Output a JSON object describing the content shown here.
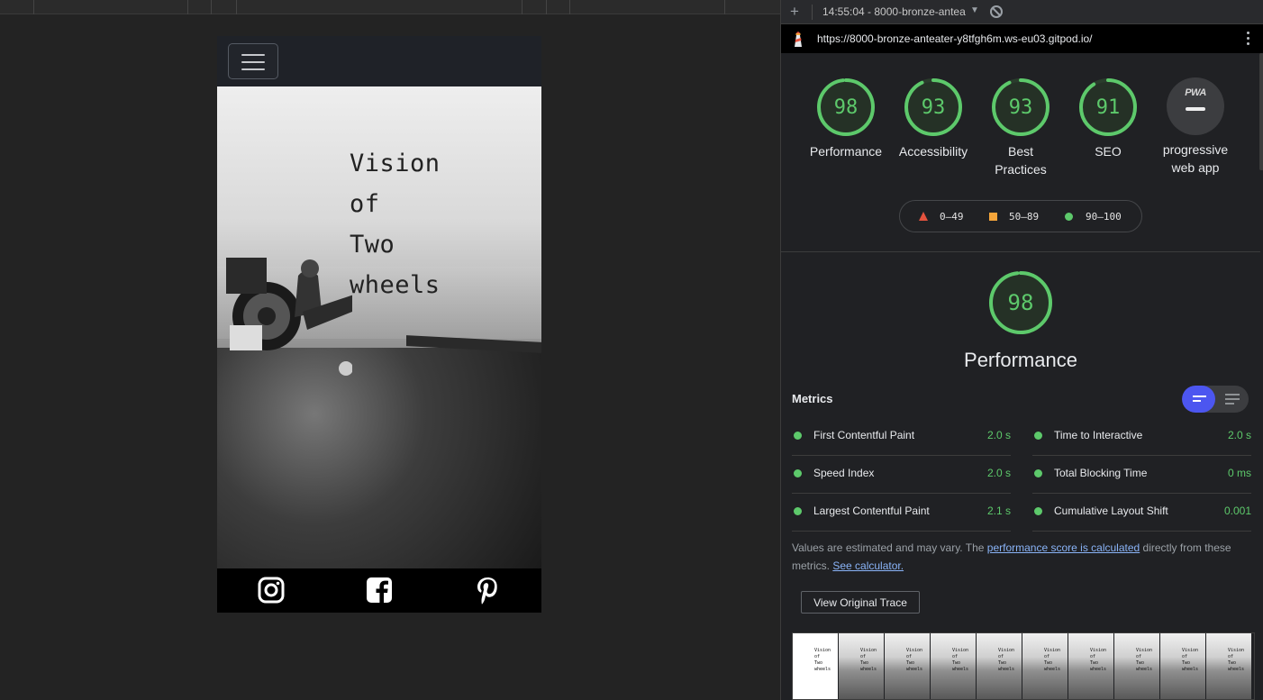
{
  "preview": {
    "hero_title_lines": [
      "Vision",
      "of",
      "Two",
      "wheels"
    ],
    "social_icons": [
      "instagram-icon",
      "facebook-icon",
      "pinterest-icon"
    ]
  },
  "devtools": {
    "report_label": "14:55:04 - 8000-bronze-antea",
    "url": "https://8000-bronze-anteater-y8tfgh6m.ws-eu03.gitpod.io/",
    "gauges": [
      {
        "score": 98,
        "label": "Performance"
      },
      {
        "score": 93,
        "label": "Accessibility"
      },
      {
        "score": 93,
        "label": "Best Practices"
      },
      {
        "score": 91,
        "label": "SEO"
      }
    ],
    "pwa": {
      "badge": "PWA",
      "label": "progressive web app"
    },
    "legend": {
      "fail": "0–49",
      "average": "50–89",
      "pass": "90–100"
    },
    "performance": {
      "score": 98,
      "title": "Performance"
    },
    "metrics_title": "Metrics",
    "metrics": [
      {
        "name": "First Contentful Paint",
        "value": "2.0 s"
      },
      {
        "name": "Time to Interactive",
        "value": "2.0 s"
      },
      {
        "name": "Speed Index",
        "value": "2.0 s"
      },
      {
        "name": "Total Blocking Time",
        "value": "0 ms"
      },
      {
        "name": "Largest Contentful Paint",
        "value": "2.1 s"
      },
      {
        "name": "Cumulative Layout Shift",
        "value": "0.001"
      }
    ],
    "note": {
      "prefix": "Values are estimated and may vary. The ",
      "link1": "performance score is calculated",
      "middle": " directly from these metrics. ",
      "link2": "See calculator."
    },
    "trace_button": "View Original Trace",
    "colors": {
      "pass": "#5dc96b",
      "average": "#f5a53a",
      "fail": "#e5533e",
      "toggle_active": "#4c56f0"
    }
  }
}
